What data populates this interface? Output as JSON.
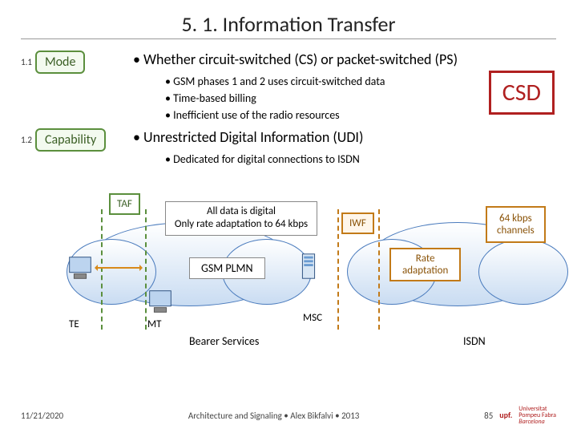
{
  "title": "5. 1. Information Transfer",
  "sections": [
    {
      "num": "1.1",
      "badge": "Mode",
      "headline": "Whether circuit-switched (CS) or packet-switched (PS)",
      "subs": [
        "GSM phases 1 and 2 uses circuit-switched data",
        "Time-based billing",
        "Inefficient use of the radio resources"
      ]
    },
    {
      "num": "1.2",
      "badge": "Capability",
      "headline": "Unrestricted Digital Information (UDI)",
      "subs": [
        "Dedicated for digital connections to ISDN"
      ]
    }
  ],
  "csd": "CSD",
  "diagram": {
    "taf": "TAF",
    "info_l1": "All data is digital",
    "info_l2": "Only rate adaptation to 64 kbps",
    "iwf": "IWF",
    "rate_l1": "Rate",
    "rate_l2": "adaptation",
    "chan_l1": "64 kbps",
    "chan_l2": "channels",
    "plmn": "GSM PLMN",
    "te": "TE",
    "mt": "MT",
    "msc": "MSC",
    "bearer": "Bearer Services",
    "isdn": "ISDN"
  },
  "footer": {
    "date": "11/21/2020",
    "center": "Architecture and Signaling • Alex Bikfalvi • 2013",
    "page": "85",
    "logo_l1": "upf.",
    "logo_l2": "Universitat",
    "logo_l3": "Pompeu Fabra",
    "logo_l4": "Barcelona"
  }
}
